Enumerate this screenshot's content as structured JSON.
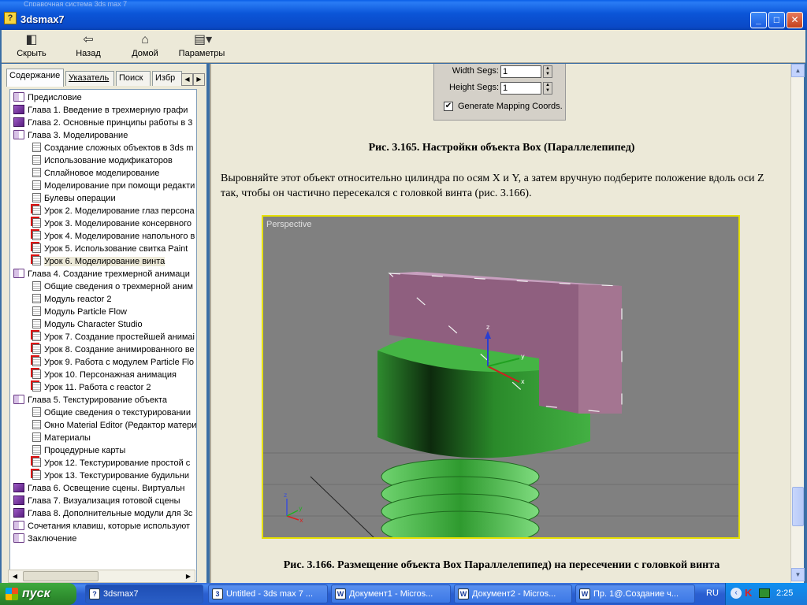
{
  "window": {
    "ghost_title": "Справочная система 3ds max 7",
    "title": "3dsmax7",
    "icon": "help-question-icon",
    "controls": [
      "minimize-icon",
      "maximize-icon",
      "close-icon"
    ]
  },
  "toolbar": {
    "buttons": [
      {
        "label": "Скрыть",
        "icon": "hide-panel-icon"
      },
      {
        "label": "Назад",
        "icon": "back-arrow-icon"
      },
      {
        "label": "Домой",
        "icon": "home-icon"
      },
      {
        "label": "Параметры",
        "icon": "options-icon"
      }
    ]
  },
  "sidebar": {
    "tabs": [
      "Содержание",
      "Указатель",
      "Поиск",
      "Избр"
    ],
    "active_tab": "Содержание",
    "tree": [
      {
        "level": 0,
        "icon": "book-open",
        "label": "Предисловие"
      },
      {
        "level": 0,
        "icon": "book",
        "label": "Глава 1. Введение в трехмерную графи"
      },
      {
        "level": 0,
        "icon": "book",
        "label": "Глава 2. Основные принципы работы в 3"
      },
      {
        "level": 0,
        "icon": "book-open",
        "label": "Глава 3. Моделирование"
      },
      {
        "level": 1,
        "icon": "page",
        "label": "Создание сложных объектов в 3ds m"
      },
      {
        "level": 1,
        "icon": "page",
        "label": "Использование модификаторов"
      },
      {
        "level": 1,
        "icon": "page",
        "label": "Сплайновое моделирование"
      },
      {
        "level": 1,
        "icon": "page",
        "label": "Моделирование при помощи редакти"
      },
      {
        "level": 1,
        "icon": "page",
        "label": "Булевы операции"
      },
      {
        "level": 1,
        "icon": "page-red",
        "label": "Урок 2. Моделирование глаз персона"
      },
      {
        "level": 1,
        "icon": "page-red",
        "label": "Урок 3. Моделирование консервного"
      },
      {
        "level": 1,
        "icon": "page-red",
        "label": "Урок 4. Моделирование напольного в"
      },
      {
        "level": 1,
        "icon": "page-red",
        "label": "Урок 5. Использование свитка Paint"
      },
      {
        "level": 1,
        "icon": "page-red",
        "label": "Урок 6. Моделирование винта",
        "selected": true
      },
      {
        "level": 0,
        "icon": "book-open",
        "label": "Глава 4. Создание трехмерной анимаци"
      },
      {
        "level": 1,
        "icon": "page",
        "label": "Общие сведения о трехмерной аним"
      },
      {
        "level": 1,
        "icon": "page",
        "label": "Модуль reactor 2"
      },
      {
        "level": 1,
        "icon": "page",
        "label": "Модуль Particle Flow"
      },
      {
        "level": 1,
        "icon": "page",
        "label": "Модуль Character Studio"
      },
      {
        "level": 1,
        "icon": "page-red",
        "label": "Урок 7. Создание простейшей анимаі"
      },
      {
        "level": 1,
        "icon": "page-red",
        "label": "Урок 8. Создание анимированного ве"
      },
      {
        "level": 1,
        "icon": "page-red",
        "label": "Урок 9. Работа с модулем Particle Flo"
      },
      {
        "level": 1,
        "icon": "page-red",
        "label": "Урок 10. Персонажная анимация"
      },
      {
        "level": 1,
        "icon": "page-red",
        "label": "Урок 11. Работа с reactor 2"
      },
      {
        "level": 0,
        "icon": "book-open",
        "label": "Глава 5. Текстурирование объекта"
      },
      {
        "level": 1,
        "icon": "page",
        "label": "Общие сведения о текстурировании"
      },
      {
        "level": 1,
        "icon": "page",
        "label": "Окно Material Editor (Редактор матери"
      },
      {
        "level": 1,
        "icon": "page",
        "label": "Материалы"
      },
      {
        "level": 1,
        "icon": "page",
        "label": "Процедурные карты"
      },
      {
        "level": 1,
        "icon": "page-red",
        "label": "Урок 12. Текстурирование простой с"
      },
      {
        "level": 1,
        "icon": "page-red",
        "label": "Урок 13. Текстурирование будильни"
      },
      {
        "level": 0,
        "icon": "book",
        "label": "Глава 6. Освещение сцены. Виртуальн"
      },
      {
        "level": 0,
        "icon": "book",
        "label": "Глава 7. Визуализация готовой сцены"
      },
      {
        "level": 0,
        "icon": "book",
        "label": "Глава 8. Дополнительные модули для 3с"
      },
      {
        "level": 0,
        "icon": "book-open",
        "label": "Сочетания клавиш, которые используют"
      },
      {
        "level": 0,
        "icon": "book-open",
        "label": "Заключение"
      }
    ]
  },
  "content": {
    "params": {
      "width_segs_label": "Width Segs:",
      "width_segs_value": "1",
      "height_segs_label": "Height Segs:",
      "height_segs_value": "1",
      "mapping_label": "Generate Mapping Coords.",
      "mapping_checked": true
    },
    "caption1": "Рис. 3.165. Настройки объекта Box (Параллелепипед)",
    "paragraph": "Выровняйте этот объект относительно цилиндра по осям X и Y, а затем вручную подберите положение вдоль оси Z так, чтобы он частично пересекался с головкой винта (рис. 3.166).",
    "viewport_label": "Perspective",
    "axis_z": "z",
    "axis_x": "x",
    "axis_y": "y",
    "caption2": "Рис. 3.166. Размещение объекта Box Параллелепипед) на пересечении с головкой винта"
  },
  "taskbar": {
    "start_label": "пуск",
    "tasks": [
      {
        "label": "3dsmax7",
        "icon": "help-icon",
        "active": true
      },
      {
        "label": "Untitled - 3ds max 7 ...",
        "icon": "3dsmax-icon"
      },
      {
        "label": "Документ1 - Micros...",
        "icon": "word-icon"
      },
      {
        "label": "Документ2 - Micros...",
        "icon": "word-icon"
      },
      {
        "label": "Пр. 1@.Создание ч...",
        "icon": "word-icon"
      }
    ],
    "language": "RU",
    "time": "2:25"
  },
  "colors": {
    "titlebar": "#0b55d8",
    "viewport_border": "#e6e000",
    "box_face": "#8f5f7f",
    "cylinder": "#3aa83a"
  }
}
